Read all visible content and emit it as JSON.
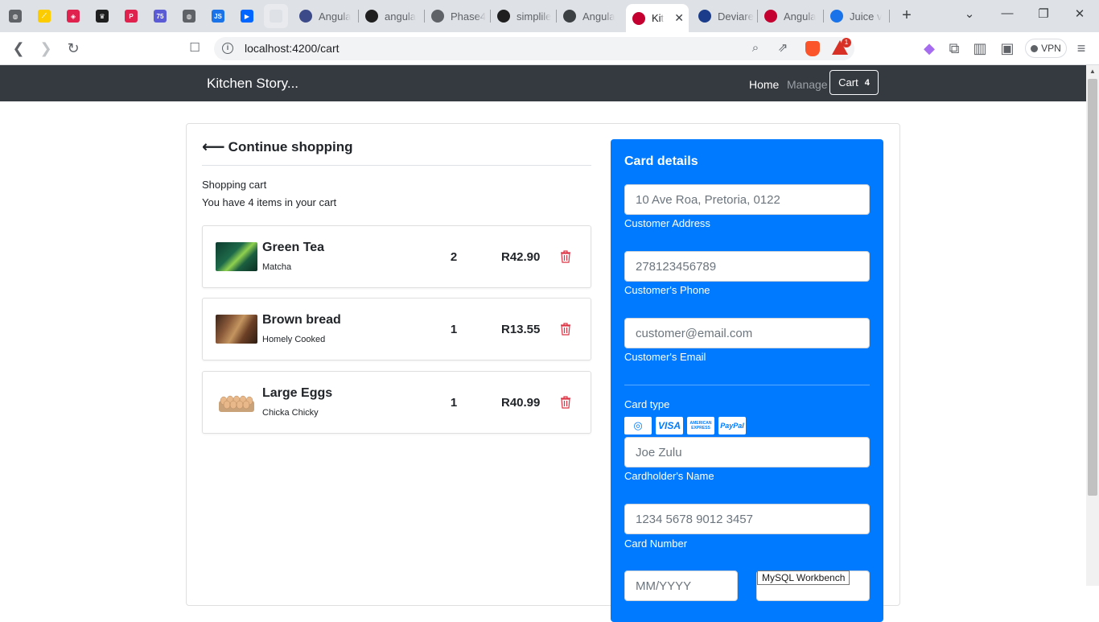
{
  "browser": {
    "pinned_tabs": [
      {
        "icon": "globe-icon",
        "color": "#5f6368",
        "glyph": "◍"
      },
      {
        "icon": "notes-icon",
        "color": "#fccc00",
        "glyph": "⟋"
      },
      {
        "icon": "nestjs-icon",
        "color": "#e0234e",
        "glyph": "◈"
      },
      {
        "icon": "crown-icon",
        "color": "#1f1f1f",
        "glyph": "♛"
      },
      {
        "icon": "p-icon",
        "color": "#e0234e",
        "glyph": "P"
      },
      {
        "icon": "badge-75-icon",
        "color": "#5b5bd6",
        "glyph": "75"
      },
      {
        "icon": "globe-icon",
        "color": "#5f6368",
        "glyph": "◍"
      },
      {
        "icon": "js-icon",
        "color": "#1a73e8",
        "glyph": "JS"
      },
      {
        "icon": "power-automate-icon",
        "color": "#0066ff",
        "glyph": "▶"
      },
      {
        "icon": "blank-icon",
        "color": "#dee1e6",
        "glyph": ""
      }
    ],
    "tabs": [
      {
        "title": "Angula",
        "icon": "angular-dark-icon",
        "color": "#3c4a8a"
      },
      {
        "title": "angula",
        "icon": "github-icon",
        "color": "#1f1f1f"
      },
      {
        "title": "Phase4",
        "icon": "phase-icon",
        "color": "#5f6368"
      },
      {
        "title": "simplile",
        "icon": "github-icon",
        "color": "#1f1f1f"
      },
      {
        "title": "Angula",
        "icon": "openai-icon",
        "color": "#3c4043"
      },
      {
        "title": "Kit",
        "icon": "angular-icon",
        "color": "#c3002f",
        "active": true,
        "close": "✕"
      },
      {
        "title": "Deviare",
        "icon": "deviare-icon",
        "color": "#1a3c8a"
      },
      {
        "title": "Angula",
        "icon": "angular-icon",
        "color": "#c3002f"
      },
      {
        "title": "Juice v",
        "icon": "forms-icon",
        "color": "#1a73e8"
      }
    ],
    "url": "localhost:4200/cart",
    "vpn_label": "VPN",
    "brave_badge": "1"
  },
  "navbar": {
    "brand": "Kitchen Story...",
    "links": [
      {
        "label": "Home",
        "color": "#ffffff"
      },
      {
        "label": "Manage",
        "color": "#9aa0a6"
      }
    ],
    "cart_label": "Cart",
    "cart_count": "4"
  },
  "cart": {
    "continue_label": "Continue shopping",
    "title": "Shopping cart",
    "subtitle": "You have 4 items in your cart",
    "items": [
      {
        "name": "Green Tea",
        "desc": "Matcha",
        "qty": "2",
        "price": "R42.90",
        "thumb": "green-tea-image"
      },
      {
        "name": "Brown bread",
        "desc": "Homely Cooked",
        "qty": "1",
        "price": "R13.55",
        "thumb": "brown-bread-image"
      },
      {
        "name": "Large Eggs",
        "desc": "Chicka Chicky",
        "qty": "1",
        "price": "R40.99",
        "thumb": "eggs-image"
      }
    ]
  },
  "payment": {
    "title": "Card details",
    "address": {
      "placeholder": "10 Ave Roa, Pretoria, 0122",
      "label": "Customer Address"
    },
    "phone": {
      "placeholder": "278123456789",
      "label": "Customer's Phone"
    },
    "email": {
      "placeholder": "customer@email.com",
      "label": "Customer's Email"
    },
    "card_type_label": "Card type",
    "card_types": [
      "MasterCard",
      "VISA",
      "AMERICAN EXPRESS",
      "PayPal"
    ],
    "holder": {
      "placeholder": "Joe Zulu",
      "label": "Cardholder's Name"
    },
    "number": {
      "placeholder": "1234 5678 9012 3457",
      "label": "Card Number"
    },
    "expiry": {
      "placeholder": "MM/YYYY"
    }
  },
  "tooltip": "MySQL Workbench",
  "colors": {
    "navbar_bg": "#343a40",
    "payment_bg": "#007bff",
    "trash": "#dc3545"
  }
}
